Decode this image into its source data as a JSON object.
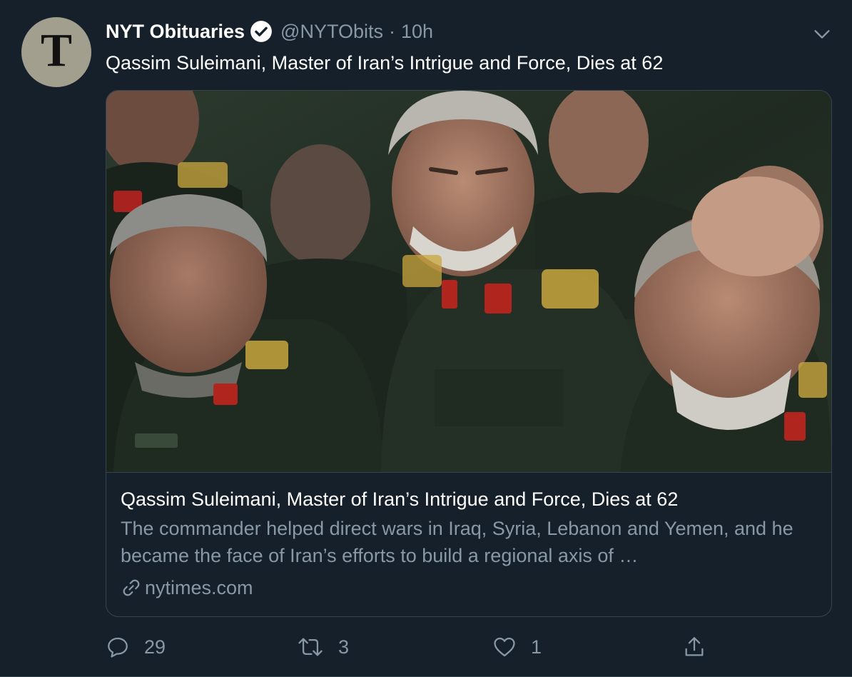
{
  "tweet": {
    "avatar_glyph": "T",
    "display_name": "NYT Obituaries",
    "verified_icon": "verified-badge-icon",
    "handle": "@NYTObits",
    "separator": "·",
    "time": "10h",
    "text": "Qassim Suleimani, Master of Iran’s Intrigue and Force, Dies at 62"
  },
  "card": {
    "title": "Qassim Suleimani, Master of Iran’s Intrigue and Force, Dies at 62",
    "description": "The commander helped direct wars in Iraq, Syria, Lebanon and Yemen, and he became the face of Iran’s efforts to build a regional axis of …",
    "domain": "nytimes.com"
  },
  "actions": {
    "reply_count": "29",
    "retweet_count": "3",
    "like_count": "1"
  },
  "colors": {
    "background": "#15202b",
    "border": "#38444d",
    "secondary_text": "#8899a6",
    "avatar_bg": "#a39f8f"
  }
}
